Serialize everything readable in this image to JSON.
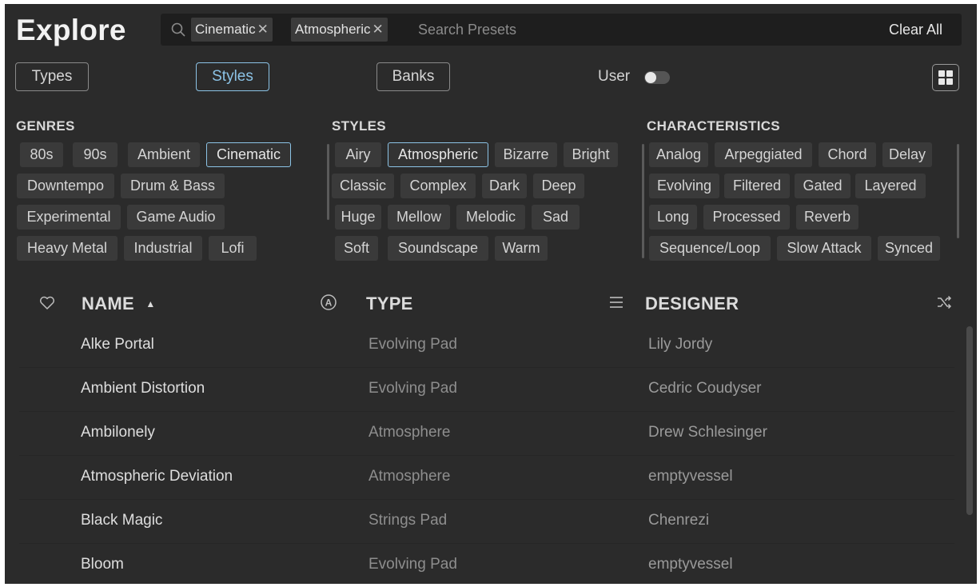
{
  "header": {
    "title": "Explore",
    "search": {
      "tags": [
        "Cinematic",
        "Atmospheric"
      ],
      "placeholder": "Search Presets",
      "clear_label": "Clear All"
    }
  },
  "toolbar": {
    "tabs": [
      {
        "label": "Types",
        "active": false
      },
      {
        "label": "Styles",
        "active": true
      },
      {
        "label": "Banks",
        "active": false
      }
    ],
    "user_label": "User",
    "user_toggle_on": false
  },
  "filters": {
    "genres": {
      "heading": "GENRES",
      "chips": [
        "80s",
        "90s",
        "Ambient",
        "Cinematic",
        "Downtempo",
        "Drum & Bass",
        "Experimental",
        "Game Audio",
        "Heavy Metal",
        "Industrial",
        "Lofi"
      ],
      "selected": [
        "Cinematic"
      ]
    },
    "styles": {
      "heading": "STYLES",
      "chips": [
        "Airy",
        "Atmospheric",
        "Bizarre",
        "Bright",
        "Classic",
        "Complex",
        "Dark",
        "Deep",
        "Huge",
        "Mellow",
        "Melodic",
        "Sad",
        "Soft",
        "Soundscape",
        "Warm"
      ],
      "selected": [
        "Atmospheric"
      ]
    },
    "characteristics": {
      "heading": "CHARACTERISTICS",
      "chips": [
        "Analog",
        "Arpeggiated",
        "Chord",
        "Delay",
        "Evolving",
        "Filtered",
        "Gated",
        "Layered",
        "Long",
        "Processed",
        "Reverb",
        "Sequence/Loop",
        "Slow Attack",
        "Synced"
      ],
      "selected": []
    }
  },
  "table": {
    "columns": {
      "name": "NAME",
      "type": "TYPE",
      "designer": "DESIGNER"
    },
    "sort": {
      "column": "name",
      "direction": "ascending"
    },
    "rows": [
      {
        "name": "Alke Portal",
        "type": "Evolving Pad",
        "designer": "Lily Jordy"
      },
      {
        "name": "Ambient Distortion",
        "type": "Evolving Pad",
        "designer": "Cedric Coudyser"
      },
      {
        "name": "Ambilonely",
        "type": "Atmosphere",
        "designer": "Drew Schlesinger"
      },
      {
        "name": "Atmospheric Deviation",
        "type": "Atmosphere",
        "designer": "emptyvessel"
      },
      {
        "name": "Black Magic",
        "type": "Strings Pad",
        "designer": "Chenrezi"
      },
      {
        "name": "Bloom",
        "type": "Evolving Pad",
        "designer": "emptyvessel"
      }
    ]
  },
  "colors": {
    "background": "#2b2b2b",
    "accent": "#8cc3e6",
    "chip": "#3a3a3a"
  }
}
